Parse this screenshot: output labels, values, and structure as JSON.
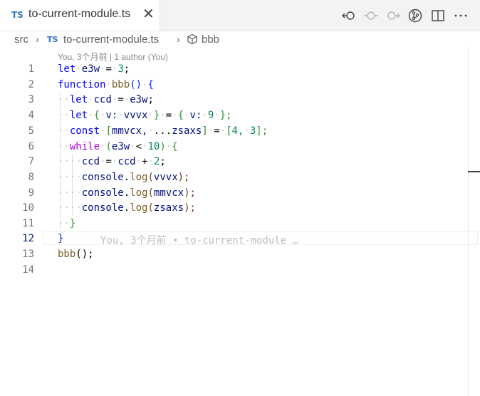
{
  "tab": {
    "lang": "TS",
    "filename": "to-current-module.ts",
    "close": "✕"
  },
  "actions": [
    "timeline-back-icon",
    "timeline-dot-icon",
    "timeline-forward-icon",
    "source-control-icon",
    "split-editor-icon",
    "more-icon"
  ],
  "breadcrumb": {
    "folder": "src",
    "lang": "TS",
    "file": "to-current-module.ts",
    "symbol": "bbb"
  },
  "blame_header": "You, 3个月前 | 1 author (You)",
  "line_numbers": [
    "1",
    "2",
    "3",
    "4",
    "5",
    "6",
    "7",
    "8",
    "9",
    "10",
    "11",
    "12",
    "13",
    "14"
  ],
  "current_line": "12",
  "code": {
    "l1": {
      "t1": "let",
      "t2": "e3w",
      "t3": "=",
      "t4": "3",
      "t5": ";"
    },
    "l2": {
      "t1": "function",
      "t2": "bbb",
      "t3": "()",
      "t4": "{"
    },
    "l3": {
      "t1": "let",
      "t2": "ccd",
      "t3": "=",
      "t4": "e3w",
      "t5": ";"
    },
    "l4": {
      "t1": "let",
      "t2": "{",
      "t3": "v:",
      "t4": "vvvx",
      "t5": "}",
      "t6": "=",
      "t7": "{",
      "t8": "v:",
      "t9": "9",
      "t10": "};"
    },
    "l5": {
      "t1": "const",
      "t2": "[",
      "t3": "mmvcx,",
      "t4": "...",
      "t5": "zsaxs",
      "t6": "]",
      "t7": "=",
      "t8": "[",
      "t9": "4,",
      "t10": "3",
      "t11": "];"
    },
    "l6": {
      "t1": "while",
      "t2": "(",
      "t3": "e3w",
      "t4": "<",
      "t5": "10",
      "t6": ")",
      "t7": "{"
    },
    "l7": {
      "t1": "ccd",
      "t2": "=",
      "t3": "ccd",
      "t4": "+",
      "t5": "2",
      "t6": ";"
    },
    "l8": {
      "t1": "console",
      "t2": ".",
      "t3": "log",
      "t4": "(",
      "t5": "vvvx",
      "t6": ");"
    },
    "l9": {
      "t1": "console",
      "t2": ".",
      "t3": "log",
      "t4": "(",
      "t5": "mmvcx",
      "t6": ");"
    },
    "l10": {
      "t1": "console",
      "t2": ".",
      "t3": "log",
      "t4": "(",
      "t5": "zsaxs",
      "t6": ");"
    },
    "l11": {
      "t1": "}"
    },
    "l12": {
      "t1": "}"
    },
    "l13": {
      "t1": "bbb",
      "t2": "();"
    }
  },
  "inline_blame": "You, 3个月前 • to-current-module …"
}
